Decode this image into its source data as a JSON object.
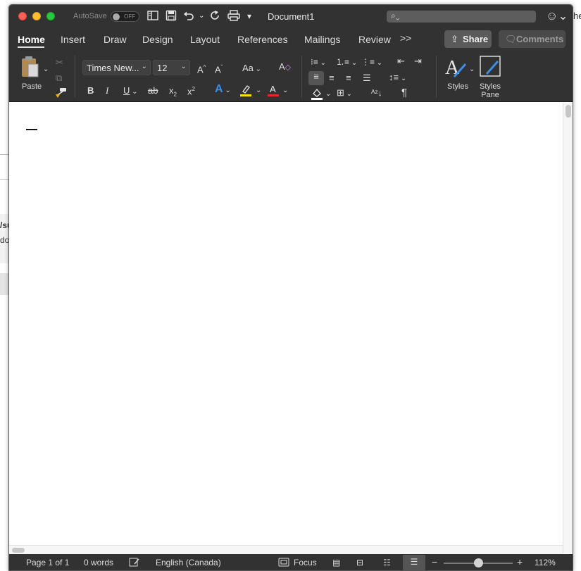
{
  "window": {
    "autosave_label": "AutoSave",
    "autosave_state": "OFF",
    "document_title": "Document1",
    "search_placeholder": ""
  },
  "tabs": [
    "Home",
    "Insert",
    "Draw",
    "Design",
    "Layout",
    "References",
    "Mailings",
    "Review"
  ],
  "tabs_overflow": ">>",
  "buttons": {
    "share": "Share",
    "comments": "Comments"
  },
  "ribbon": {
    "paste_label": "Paste",
    "font_name": "Times New...",
    "font_size": "12",
    "styles_label": "Styles",
    "styles_pane_label": "Styles Pane",
    "bold": "B",
    "italic": "I",
    "underline": "U",
    "strikethrough": "ab",
    "subscript": "x",
    "superscript": "x",
    "change_case": "Aa",
    "pilcrow": "¶"
  },
  "status": {
    "page": "Page 1 of 1",
    "words": "0 words",
    "language": "English (Canada)",
    "focus": "Focus",
    "zoom": "112%",
    "zoom_minus": "−",
    "zoom_plus": "+"
  },
  "background": {
    "text_1": "/su",
    "text_2": "do",
    "text_3": "he"
  },
  "colors": {
    "titlebar": "#323232",
    "close": "#fe5f57",
    "minimize": "#febc2e",
    "maximize": "#28c840",
    "highlight": "#f7e600",
    "font_color": "#e8272c",
    "text_effects": "#3b8fe6"
  }
}
